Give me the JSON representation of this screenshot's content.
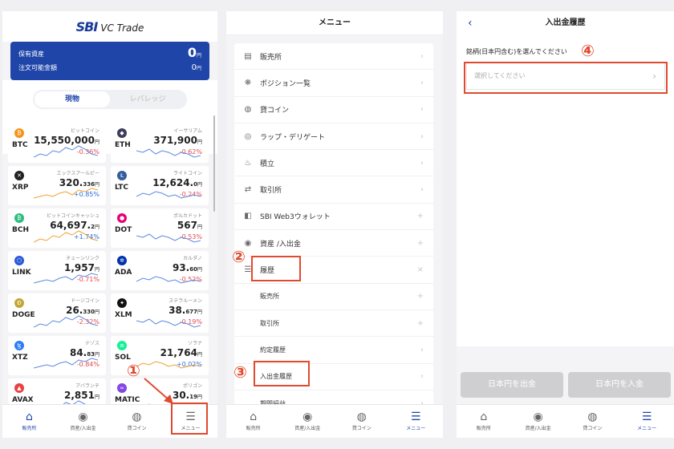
{
  "panel1": {
    "logo_brand": "SBI",
    "logo_text": "VC Trade",
    "asset_label1": "保有資産",
    "asset_label2": "注文可能金額",
    "asset_value1": "0",
    "asset_value2": "0",
    "yen": "円",
    "tab_spot": "現物",
    "tab_leverage": "レバレッジ",
    "coins": [
      {
        "sym": "BTC",
        "jp": "ビットコイン",
        "price": "15,550,000",
        "dec": "",
        "change": "-0.36%",
        "dir": "neg",
        "color": "#f7931a",
        "glyph": "₿"
      },
      {
        "sym": "ETH",
        "jp": "イーサリアム",
        "price": "371,900",
        "dec": "",
        "change": "-0.62%",
        "dir": "neg",
        "color": "#3c3c5c",
        "glyph": "◆"
      },
      {
        "sym": "XRP",
        "jp": "エックスアールピー",
        "price": "320.",
        "dec": "336",
        "change": "+0.85%",
        "dir": "pos",
        "color": "#222",
        "glyph": "✕"
      },
      {
        "sym": "LTC",
        "jp": "ライトコイン",
        "price": "12,624.",
        "dec": "0",
        "change": "-0.24%",
        "dir": "neg",
        "color": "#345d9d",
        "glyph": "Ł"
      },
      {
        "sym": "BCH",
        "jp": "ビットコインキャッシュ",
        "price": "64,697.",
        "dec": "2",
        "change": "+1.74%",
        "dir": "pos",
        "color": "#2bbd7e",
        "glyph": "₿"
      },
      {
        "sym": "DOT",
        "jp": "ポルカドット",
        "price": "567",
        "dec": "",
        "change": "-0.53%",
        "dir": "neg",
        "color": "#e6007a",
        "glyph": "●"
      },
      {
        "sym": "LINK",
        "jp": "チェーンリンク",
        "price": "1,957",
        "dec": "",
        "change": "-0.71%",
        "dir": "neg",
        "color": "#2a5ada",
        "glyph": "⬡"
      },
      {
        "sym": "ADA",
        "jp": "カルダノ",
        "price": "93.",
        "dec": "60",
        "change": "-0.52%",
        "dir": "neg",
        "color": "#0033ad",
        "glyph": "✲"
      },
      {
        "sym": "DOGE",
        "jp": "ドージコイン",
        "price": "26.",
        "dec": "330",
        "change": "-2.32%",
        "dir": "neg",
        "color": "#c2a633",
        "glyph": "Ð"
      },
      {
        "sym": "XLM",
        "jp": "ステラルーメン",
        "price": "38.",
        "dec": "677",
        "change": "-0.19%",
        "dir": "neg",
        "color": "#111",
        "glyph": "✦"
      },
      {
        "sym": "XTZ",
        "jp": "テゾス",
        "price": "84.",
        "dec": "83",
        "change": "-0.84%",
        "dir": "neg",
        "color": "#2c7df7",
        "glyph": "ꜩ"
      },
      {
        "sym": "SOL",
        "jp": "ソラナ",
        "price": "21,764",
        "dec": "",
        "change": "+0.02%",
        "dir": "pos",
        "color": "#14f195",
        "glyph": "≡"
      },
      {
        "sym": "AVAX",
        "jp": "アバランチ",
        "price": "2,851",
        "dec": "",
        "change": "",
        "dir": "neg",
        "color": "#e84142",
        "glyph": "▲"
      },
      {
        "sym": "MATIC",
        "jp": "ポリゴン",
        "price": "30.",
        "dec": "19",
        "change": "",
        "dir": "neg",
        "color": "#8247e5",
        "glyph": "∞"
      }
    ],
    "tabs": [
      "販売所",
      "資産/入出金",
      "貸コイン",
      "メニュー"
    ]
  },
  "panel2": {
    "title": "メニュー",
    "items": [
      {
        "label": "販売所",
        "icon": "shop-icon",
        "glyph": "▤",
        "mark": "›",
        "sub": false
      },
      {
        "label": "ポジション一覧",
        "icon": "position-icon",
        "glyph": "❋",
        "mark": "›",
        "sub": false
      },
      {
        "label": "貸コイン",
        "icon": "lend-coin-icon",
        "glyph": "◍",
        "mark": "›",
        "sub": false
      },
      {
        "label": "ラップ・デリゲート",
        "icon": "wrap-icon",
        "glyph": "◎",
        "mark": "›",
        "sub": false
      },
      {
        "label": "積立",
        "icon": "savings-icon",
        "glyph": "♨",
        "mark": "›",
        "sub": false
      },
      {
        "label": "取引所",
        "icon": "exchange-icon",
        "glyph": "⇄",
        "mark": "›",
        "sub": false
      },
      {
        "label": "SBI Web3ウォレット",
        "icon": "wallet-icon",
        "glyph": "◧",
        "mark": "+",
        "sub": false
      },
      {
        "label": "資産 /入出金",
        "icon": "asset-icon",
        "glyph": "◉",
        "mark": "+",
        "sub": false
      },
      {
        "label": "履歴",
        "icon": "history-icon",
        "glyph": "☰",
        "mark": "×",
        "sub": false
      },
      {
        "label": "販売所",
        "icon": "",
        "glyph": "",
        "mark": "+",
        "sub": true
      },
      {
        "label": "取引所",
        "icon": "",
        "glyph": "",
        "mark": "+",
        "sub": true
      },
      {
        "label": "約定履歴",
        "icon": "",
        "glyph": "",
        "mark": "›",
        "sub": true
      },
      {
        "label": "入出金履歴",
        "icon": "",
        "glyph": "",
        "mark": "›",
        "sub": true
      },
      {
        "label": "期間損益",
        "icon": "",
        "glyph": "",
        "mark": "›",
        "sub": true
      }
    ]
  },
  "panel3": {
    "title": "入出金履歴",
    "label": "銘柄(日本円含む)を選んでください",
    "placeholder": "選択してください",
    "btn_withdraw": "日本円を出金",
    "btn_deposit": "日本円を入金"
  },
  "annotations": [
    "①",
    "②",
    "③",
    "④"
  ]
}
